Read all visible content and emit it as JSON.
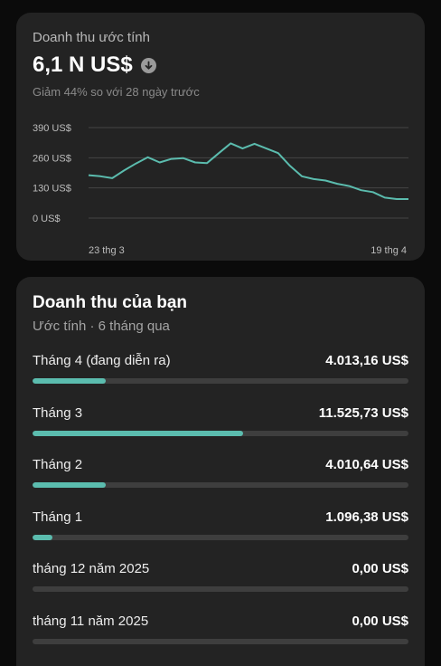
{
  "estimate": {
    "title": "Doanh thu ước tính",
    "value": "6,1 N US$",
    "change_icon": "arrow-down-circle-icon",
    "subtitle": "Giảm 44% so với 28 ngày trước"
  },
  "chart_data": {
    "type": "line",
    "y_ticks": [
      "390 US$",
      "260 US$",
      "130 US$",
      "0 US$"
    ],
    "y_tick_values": [
      390,
      260,
      130,
      0
    ],
    "x_tick_labels": [
      "23 thg 3",
      "19 thg 4"
    ],
    "ylim": [
      0,
      390
    ],
    "grid": true,
    "color": "#5bbcae",
    "values": [
      185,
      180,
      172,
      205,
      235,
      262,
      240,
      255,
      258,
      240,
      237,
      280,
      322,
      300,
      320,
      300,
      280,
      225,
      180,
      168,
      162,
      148,
      138,
      120,
      112,
      88,
      82,
      82
    ]
  },
  "revenue": {
    "title": "Doanh thu của bạn",
    "subtitle": "Ước tính · 6 tháng qua",
    "accent": "#5bbcae",
    "months": [
      {
        "label": "Tháng 4 (đang diễn ra)",
        "value": "4.013,16 US$",
        "fraction": 0.195
      },
      {
        "label": "Tháng 3",
        "value": "11.525,73 US$",
        "fraction": 0.56
      },
      {
        "label": "Tháng 2",
        "value": "4.010,64 US$",
        "fraction": 0.195
      },
      {
        "label": "Tháng 1",
        "value": "1.096,38 US$",
        "fraction": 0.053
      },
      {
        "label": "tháng 12 năm 2025",
        "value": "0,00 US$",
        "fraction": 0
      },
      {
        "label": "tháng 11 năm 2025",
        "value": "0,00 US$",
        "fraction": 0
      }
    ]
  }
}
